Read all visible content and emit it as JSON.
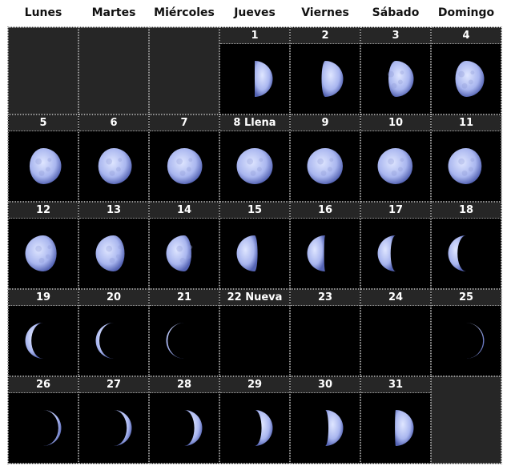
{
  "weekdays": [
    "Lunes",
    "Martes",
    "Miércoles",
    "Jueves",
    "Viernes",
    "Sábado",
    "Domingo"
  ],
  "days": [
    {
      "label": "1",
      "illum": 0.5,
      "waxing": true
    },
    {
      "label": "2",
      "illum": 0.6,
      "waxing": true
    },
    {
      "label": "3",
      "illum": 0.7,
      "waxing": true
    },
    {
      "label": "4",
      "illum": 0.8,
      "waxing": true
    },
    {
      "label": "5",
      "illum": 0.88,
      "waxing": true
    },
    {
      "label": "6",
      "illum": 0.93,
      "waxing": true
    },
    {
      "label": "7",
      "illum": 0.97,
      "waxing": true
    },
    {
      "label": "8 Llena",
      "illum": 1.0,
      "waxing": false
    },
    {
      "label": "9",
      "illum": 0.99,
      "waxing": false
    },
    {
      "label": "10",
      "illum": 0.97,
      "waxing": false
    },
    {
      "label": "11",
      "illum": 0.93,
      "waxing": false
    },
    {
      "label": "12",
      "illum": 0.87,
      "waxing": false
    },
    {
      "label": "13",
      "illum": 0.8,
      "waxing": false
    },
    {
      "label": "14",
      "illum": 0.7,
      "waxing": false
    },
    {
      "label": "15",
      "illum": 0.58,
      "waxing": false
    },
    {
      "label": "16",
      "illum": 0.47,
      "waxing": false
    },
    {
      "label": "17",
      "illum": 0.36,
      "waxing": false
    },
    {
      "label": "18",
      "illum": 0.26,
      "waxing": false
    },
    {
      "label": "19",
      "illum": 0.17,
      "waxing": false
    },
    {
      "label": "20",
      "illum": 0.1,
      "waxing": false
    },
    {
      "label": "21",
      "illum": 0.04,
      "waxing": false
    },
    {
      "label": "22 Nueva",
      "illum": 0.0,
      "waxing": true
    },
    {
      "label": "23",
      "illum": 0.0,
      "waxing": true
    },
    {
      "label": "24",
      "illum": 0.0,
      "waxing": true
    },
    {
      "label": "25",
      "illum": 0.03,
      "waxing": true
    },
    {
      "label": "26",
      "illum": 0.08,
      "waxing": true
    },
    {
      "label": "27",
      "illum": 0.14,
      "waxing": true
    },
    {
      "label": "28",
      "illum": 0.22,
      "waxing": true
    },
    {
      "label": "29",
      "illum": 0.31,
      "waxing": true
    },
    {
      "label": "30",
      "illum": 0.41,
      "waxing": true
    },
    {
      "label": "31",
      "illum": 0.52,
      "waxing": true
    }
  ],
  "colors": {
    "moon_light": "#dfe6ff",
    "moon_mid": "#a9b6ef",
    "moon_edge": "#5463b3",
    "cell_bg": "#000000",
    "empty_bg": "#262626"
  }
}
